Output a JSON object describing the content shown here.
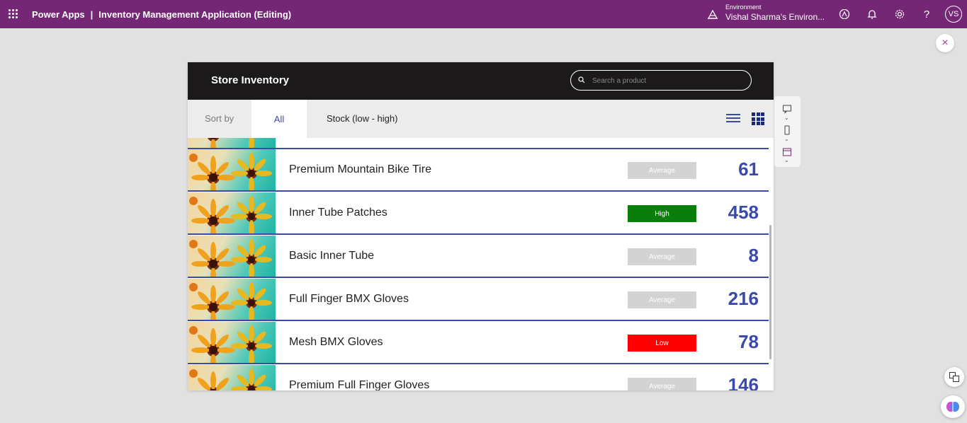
{
  "topbar": {
    "brand": "Power Apps",
    "separator": "|",
    "title": "Inventory Management Application (Editing)",
    "env_label": "Environment",
    "env_name": "Vishal Sharma's Environ...",
    "avatar": "VS",
    "help": "?",
    "bg_color": "#742774"
  },
  "close_glyph": "×",
  "app": {
    "title": "Store Inventory",
    "search_placeholder": "Search a product",
    "sort_label": "Sort by",
    "sort_all": "All",
    "sort_stock": "Stock (low - high)",
    "accent": "#3b4aa7"
  },
  "items": [
    {
      "name": "Premium Mountain Bike Tire",
      "status": "Average",
      "qty": "61",
      "status_color": "#d3d3d3"
    },
    {
      "name": "Inner Tube Patches",
      "status": "High",
      "qty": "458",
      "status_color": "#0a7d0a"
    },
    {
      "name": "Basic Inner Tube",
      "status": "Average",
      "qty": "8",
      "status_color": "#d3d3d3"
    },
    {
      "name": "Full Finger BMX Gloves",
      "status": "Average",
      "qty": "216",
      "status_color": "#d3d3d3"
    },
    {
      "name": "Mesh BMX Gloves",
      "status": "Low",
      "qty": "78",
      "status_color": "#ff0000"
    },
    {
      "name": "Premium Full Finger Gloves",
      "status": "Average",
      "qty": "146",
      "status_color": "#d3d3d3"
    }
  ]
}
